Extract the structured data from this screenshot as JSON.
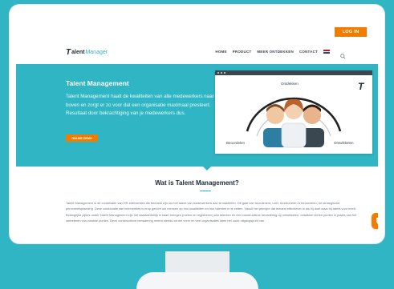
{
  "header": {
    "login_label": "LOG IN",
    "logo": {
      "mark": "T",
      "word": "alent",
      "sub": "Manager"
    },
    "nav": [
      "HOME",
      "PRODUCT",
      "MEER ONTDEKKEN",
      "CONTACT"
    ],
    "flag_colors": [
      "#ae1c28",
      "#ffffff",
      "#21468b"
    ]
  },
  "hero": {
    "title": "Talent Management",
    "text": "Talent Management haalt de kwaliteiten van alle medewerkers naar boven en zorgt er zo voor dat een organisatie maximaal presteert. Resultaat door bekrachtiging van je medewerkers dus.",
    "cta_label": "ONLINE DEMO",
    "illustration": {
      "top_label": "Ontdekken",
      "left_label": "Beoordelen",
      "right_label": "Ontwikkelen"
    }
  },
  "section": {
    "title": "Wat is Talent Management?",
    "body": "Talent Management is de combinatie van HR-interventies die bedoeld zijn om het talent van medewerkers aan te wakkeren. Dit gaat van recruitment, L&D, functioneren & beoordelen, tot strategische personeelsplanning. Deze combinatie van interventies is erop gericht om mensen op hun kwaliteiten en hun talenten in te zetten. Vanuit het principe dat iemand effectiever is als hij doet waar hij talent voor heeft. Belangrijke pijlers onder Talent Management zijn het daadwerkelijk in kaart brengen (meten en registreren) van talenten en een constructieve benadering op ontwikkelen: ontwikkel sterke punten in plaats van het verbeteren van zwakke punten. Deze constructieve benadering neemt steeds verder vorm en veel organisaties laten het oude uitgangspunt van"
  },
  "colors": {
    "accent": "#2fb5c3",
    "orange": "#f07d00",
    "dark": "#1b2a33"
  }
}
